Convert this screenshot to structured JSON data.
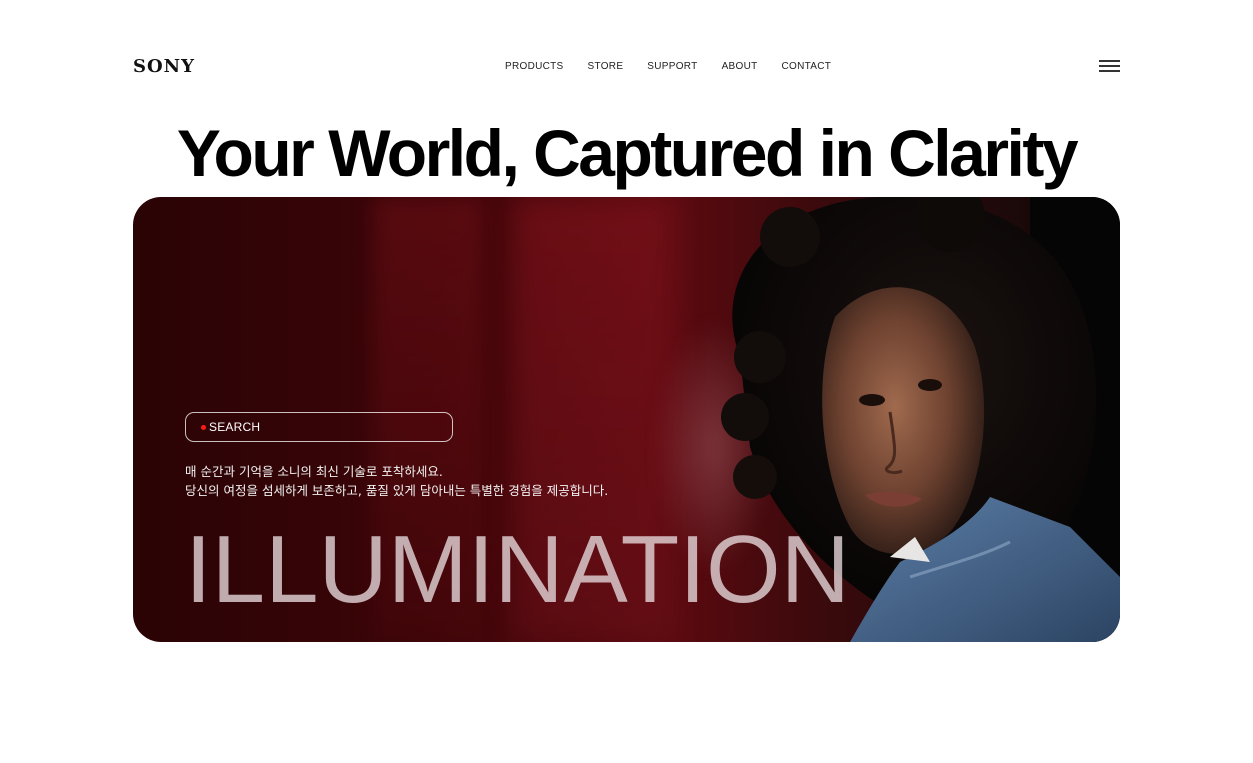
{
  "brand": {
    "logo": "SONY"
  },
  "nav": {
    "items": [
      {
        "label": "PRODUCTS"
      },
      {
        "label": "STORE"
      },
      {
        "label": "SUPPORT"
      },
      {
        "label": "ABOUT"
      },
      {
        "label": "CONTACT"
      }
    ],
    "menu_icon": "hamburger-menu-icon"
  },
  "hero": {
    "headline": "Your World, Captured in Clarity",
    "search": {
      "label": "SEARCH",
      "dot_color": "#ff1a1a"
    },
    "description": {
      "line1": "매 순간과 기억을 소니의 최신 기술로 포착하세요.",
      "line2": "당신의 여정을 섬세하게 보존하고, 품질 있게 담아내는 특별한 경험을 제공합니다."
    },
    "big_word": "ILLUMINATION",
    "colors": {
      "background": "#3c0508",
      "accent": "#ff1a1a"
    }
  }
}
